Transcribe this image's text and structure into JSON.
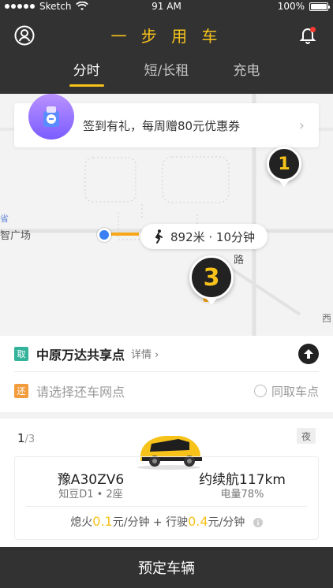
{
  "status": {
    "carrier": "Sketch",
    "time": "91 AM",
    "battery": "100%"
  },
  "header": {
    "title": "一 步 用 车",
    "tabs": [
      {
        "label": "分时",
        "active": true
      },
      {
        "label": "短/长租",
        "active": false
      },
      {
        "label": "充电",
        "active": false
      }
    ]
  },
  "banner": {
    "text": "签到有礼，每周赠80元优惠券",
    "badge_symbol": "¥"
  },
  "map": {
    "labels": {
      "place": "智广场",
      "road": "路",
      "west": "西",
      "left_char": "省"
    },
    "walk": {
      "text": "892米 · 10分钟"
    },
    "pins": [
      {
        "number": "1"
      },
      {
        "number": "3"
      }
    ]
  },
  "pickup": {
    "tag": "取",
    "name": "中原万达共享点",
    "detail": "详情 ›"
  },
  "dropoff": {
    "tag": "还",
    "placeholder": "请选择还车网点",
    "same_label": "同取车点"
  },
  "car": {
    "pager_current": "1",
    "pager_total": "/3",
    "night_label": "夜",
    "plate": "豫A30ZV6",
    "model": "知豆D1 • 2座",
    "range": "约续航117km",
    "power": "电量78%",
    "price_prefix": "熄火",
    "price_idle": "0.1",
    "price_mid": "元/分钟 + 行驶",
    "price_drive": "0.4",
    "price_suffix": "元/分钟"
  },
  "footer": {
    "cta": "预定车辆"
  },
  "colors": {
    "brand": "#f7c21a",
    "dark": "#323232",
    "blue": "#3b80f3",
    "green": "#34b39b",
    "orange": "#f39c3e"
  }
}
